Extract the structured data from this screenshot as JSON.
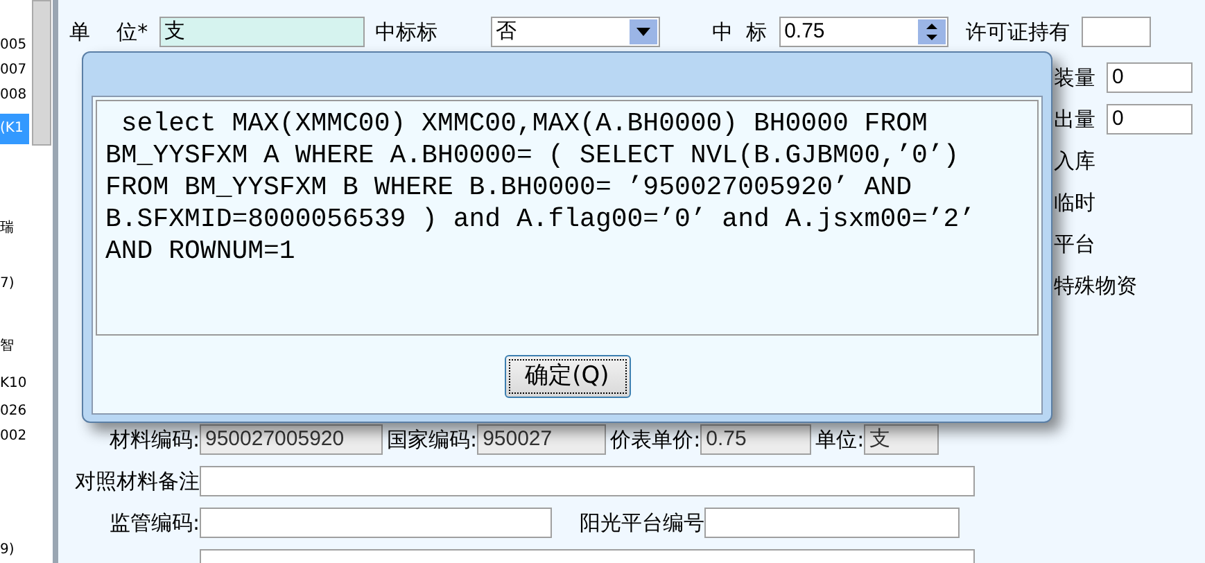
{
  "sidebar": {
    "items": [
      {
        "text": "005",
        "selected": false
      },
      {
        "text": "007",
        "selected": false
      },
      {
        "text": "008",
        "selected": false
      },
      {
        "text": "(K1",
        "selected": true
      },
      {
        "text": "瑞",
        "selected": false
      },
      {
        "text": "7)",
        "selected": false
      },
      {
        "text": "智",
        "selected": false
      },
      {
        "text": "K10",
        "selected": false
      },
      {
        "text": "026",
        "selected": false
      },
      {
        "text": "002",
        "selected": false
      },
      {
        "text": "9)",
        "selected": false
      }
    ]
  },
  "top_row": {
    "unit_label": "单    位*",
    "unit_value": "支",
    "bid_flag_label": "中标标",
    "bid_flag_value": "否",
    "bid_price_label": "中  标",
    "bid_price_value": "0.75",
    "license_label": "许可证持有"
  },
  "right_column": [
    {
      "kind": "field",
      "label": "装量",
      "value": "0"
    },
    {
      "kind": "field",
      "label": "出量",
      "value": "0"
    },
    {
      "kind": "text",
      "label": "入库"
    },
    {
      "kind": "text",
      "label": "临时"
    },
    {
      "kind": "text",
      "label": "平台"
    },
    {
      "kind": "text",
      "label": "特殊物资"
    }
  ],
  "dialog": {
    "message": " select MAX(XMMC00) XMMC00,MAX(A.BH0000) BH0000 FROM BM_YYSFXM A WHERE A.BH0000= ( SELECT NVL(B.GJBM00,’0’) FROM BM_YYSFXM B WHERE B.BH0000= ’950027005920’ AND B.SFXMID=8000056539 ) and A.flag00=’0’ and A.jsxm00=’2’ AND ROWNUM=1",
    "button": "确定(Q)"
  },
  "bottom_rows": [
    [
      {
        "label": "材料编码:",
        "value": "950027005920",
        "readonly": true
      },
      {
        "label": "国家编码:",
        "value": "950027",
        "readonly": true
      },
      {
        "label": "价表单价:",
        "value": "0.75",
        "readonly": true
      },
      {
        "label": "单位:",
        "value": "支",
        "readonly": true
      }
    ],
    [
      {
        "label": "对照材料备注",
        "readonly": false
      }
    ],
    [
      {
        "label": "监管编码:",
        "readonly": false
      },
      {
        "label": "阳光平台编号",
        "readonly": false
      }
    ],
    [
      {
        "readonly": false
      }
    ]
  ]
}
